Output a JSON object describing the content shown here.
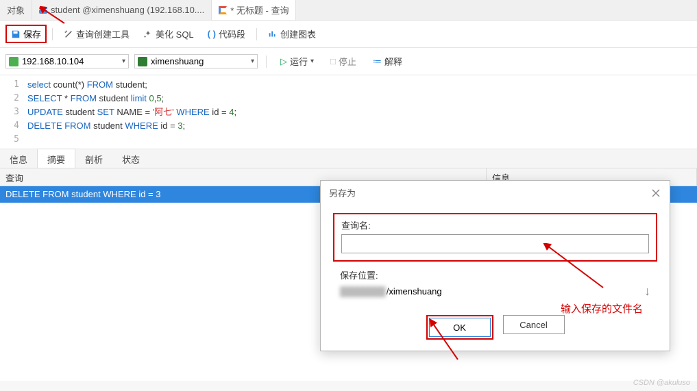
{
  "tabs": {
    "objects": "对象",
    "student": "student @ximenshuang (192.168.10....",
    "untitled": "* 无标题 - 查询"
  },
  "toolbar": {
    "save": "保存",
    "query_builder": "查询创建工具",
    "beautify": "美化 SQL",
    "snippet": "代码段",
    "chart": "创建图表"
  },
  "conn": {
    "host": "192.168.10.104",
    "db": "ximenshuang",
    "run": "运行",
    "stop": "停止",
    "explain": "解释"
  },
  "code": {
    "l1": {
      "a": "select",
      "b": " count(*) ",
      "c": "FROM",
      "d": " student;"
    },
    "l2": {
      "a": "SELECT",
      "b": " * ",
      "c": "FROM",
      "d": " student ",
      "e": "limit",
      "f": " ",
      "g": "0",
      "h": ",",
      "i": "5",
      "j": ";"
    },
    "l3": {
      "a": "UPDATE",
      "b": " student ",
      "c": "SET",
      "d": " NAME = ",
      "e": "'阿七'",
      "f": " ",
      "g": "WHERE",
      "h": " id = ",
      "i": "4",
      "j": ";"
    },
    "l4": {
      "a": "DELETE",
      "b": " ",
      "c": "FROM",
      "d": " student ",
      "e": "WHERE",
      "f": " id = ",
      "g": "3",
      "h": ";"
    }
  },
  "result_tabs": {
    "info": "信息",
    "summary": "摘要",
    "analyze": "剖析",
    "status": "状态"
  },
  "headers": {
    "query": "查询",
    "info": "信息"
  },
  "row": "DELETE FROM student WHERE id = 3",
  "dialog": {
    "title": "另存为",
    "name_label": "查询名:",
    "name_value": "",
    "loc_label": "保存位置:",
    "loc_path_suffix": "ximenshuang",
    "ok": "OK",
    "cancel": "Cancel"
  },
  "annotation": "输入保存的文件名",
  "watermark": "CSDN @akuluso"
}
